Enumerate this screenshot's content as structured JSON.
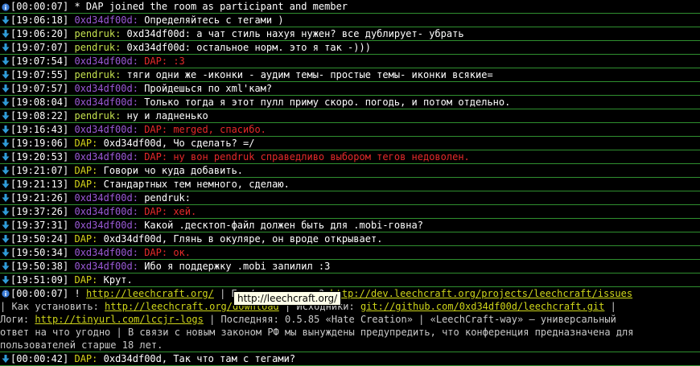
{
  "colors": {
    "border": "#2f8f2f",
    "timestamp": "#ffffff",
    "nick_dap": "#d5d51a",
    "nick_pendruk": "#c5e24f",
    "nick_0xd": "#9b5ad6",
    "highlight_red": "#e52a2a",
    "link": "#cfd61a",
    "info_icon": "#3a7bd5",
    "arrow_icon": "#2f9bd8"
  },
  "messages": [
    {
      "icon": "info-icon",
      "ts": "[00:00:07]",
      "nick": "",
      "sep": "",
      "text": " * DAP joined the room as participant and member",
      "red": false
    },
    {
      "icon": "arrow-down-icon",
      "ts": "[19:06:18]",
      "nick": "0xd34df00d",
      "sep": ":",
      "text": " Определяйтесь с тегами )",
      "red": false
    },
    {
      "icon": "arrow-down-icon",
      "ts": "[19:06:20]",
      "nick": "pendruk",
      "sep": ":",
      "text": " 0xd34df00d: а чат стиль нахуя нужен? все дублирует- убрать",
      "red": false
    },
    {
      "icon": "arrow-down-icon",
      "ts": "[19:07:07]",
      "nick": "pendruk",
      "sep": ":",
      "text": " 0xd34df00d: остальное норм. это я так -)))",
      "red": false
    },
    {
      "icon": "arrow-down-icon",
      "ts": "[19:07:54]",
      "nick": "0xd34df00d",
      "sep": ":",
      "text": " DAP: :З",
      "red": true
    },
    {
      "icon": "arrow-down-icon",
      "ts": "[19:07:55]",
      "nick": "pendruk",
      "sep": ":",
      "text": " тяги одни же -иконки - аудим темы- простые темы- иконки всякие=",
      "red": false
    },
    {
      "icon": "arrow-down-icon",
      "ts": "[19:07:57]",
      "nick": "0xd34df00d",
      "sep": ":",
      "text": " Пройдешься по xml'кам?",
      "red": false
    },
    {
      "icon": "arrow-down-icon",
      "ts": "[19:08:04]",
      "nick": "0xd34df00d",
      "sep": ":",
      "text": " Только тогда я этот пулл приму скоро. погодь, и потом отдельно.",
      "red": false
    },
    {
      "icon": "arrow-down-icon",
      "ts": "[19:08:22]",
      "nick": "pendruk",
      "sep": ":",
      "text": " ну и ладненько",
      "red": false
    },
    {
      "icon": "arrow-down-icon",
      "ts": "[19:16:43]",
      "nick": "0xd34df00d",
      "sep": ":",
      "text": " DAP: merged, спасибо.",
      "red": true
    },
    {
      "icon": "arrow-down-icon",
      "ts": "[19:19:06]",
      "nick": "DAP",
      "sep": ":",
      "text": " 0xd34df00d, Чо сделать? =/",
      "red": false
    },
    {
      "icon": "arrow-down-icon",
      "ts": "[19:20:53]",
      "nick": "0xd34df00d",
      "sep": ":",
      "text": " DAP: ну вон pendruk справедливо выбором тегов недоволен.",
      "red": true
    },
    {
      "icon": "arrow-down-icon",
      "ts": "[19:21:07]",
      "nick": "DAP",
      "sep": ":",
      "text": " Говори чо куда добавить.",
      "red": false
    },
    {
      "icon": "arrow-down-icon",
      "ts": "[19:21:13]",
      "nick": "DAP",
      "sep": ":",
      "text": " Стандартных тем немного, сделаю.",
      "red": false
    },
    {
      "icon": "arrow-down-icon",
      "ts": "[19:21:26]",
      "nick": "0xd34df00d",
      "sep": ":",
      "text": " pendruk:",
      "red": false
    },
    {
      "icon": "arrow-down-icon",
      "ts": "[19:37:26]",
      "nick": "0xd34df00d",
      "sep": ":",
      "text": " DAP: хей.",
      "red": true
    },
    {
      "icon": "arrow-down-icon",
      "ts": "[19:37:31]",
      "nick": "0xd34df00d",
      "sep": ":",
      "text": " Какой .десктоп-файл должен быть для .mobi-говна?",
      "red": false
    },
    {
      "icon": "arrow-down-icon",
      "ts": "[19:50:24]",
      "nick": "DAP",
      "sep": ":",
      "text": " 0xd34df00d, Глянь в окуляре, он вроде открывает.",
      "red": false
    },
    {
      "icon": "arrow-down-icon",
      "ts": "[19:50:34]",
      "nick": "0xd34df00d",
      "sep": ":",
      "text": " DAP: ок.",
      "red": true
    },
    {
      "icon": "arrow-down-icon",
      "ts": "[19:50:38]",
      "nick": "0xd34df00d",
      "sep": ":",
      "text": " Ибо я поддержку .mobi запилил :З",
      "red": false
    },
    {
      "icon": "arrow-down-icon",
      "ts": "[19:51:09]",
      "nick": "DAP",
      "sep": ":",
      "text": " Крут.",
      "red": false
    }
  ],
  "topic": {
    "icon": "info-icon",
    "ts": "[00:00:07]",
    "row1_prefix": " ! ",
    "link_site": "http://leechcraft.org/",
    "row1_mid": " | Баг/предложение? ",
    "link_issues": "http://dev.leechcraft.org/projects/leechcraft/issues",
    "row2_prefix": "| Как установить: ",
    "link_download": "http://leechcraft.org/download",
    "row2_mid": " | Исходники: ",
    "link_git": "git://github.com/0xd34df00d/leechcraft.git",
    "row2_suffix": " |",
    "row3_prefix": "Логи: ",
    "link_logs": "http://tinyurl.com/lccjr-logs",
    "row3_suffix": " | Последняя: 0.5.85 «Hate Creation» | «LeechCraft-way» — универсальный",
    "row4": "ответ на что угодно | В связи с новым законом РФ мы вынуждены предупредить, что конференция предназначена для",
    "row5": "пользователей старше 18 лет."
  },
  "last_message": {
    "icon": "arrow-down-icon",
    "ts": "[00:00:42]",
    "nick": "DAP",
    "sep": ":",
    "text": " 0xd34df00d, Так что там с тегами?",
    "red": false
  },
  "tooltip": "http://leechcraft.org/"
}
